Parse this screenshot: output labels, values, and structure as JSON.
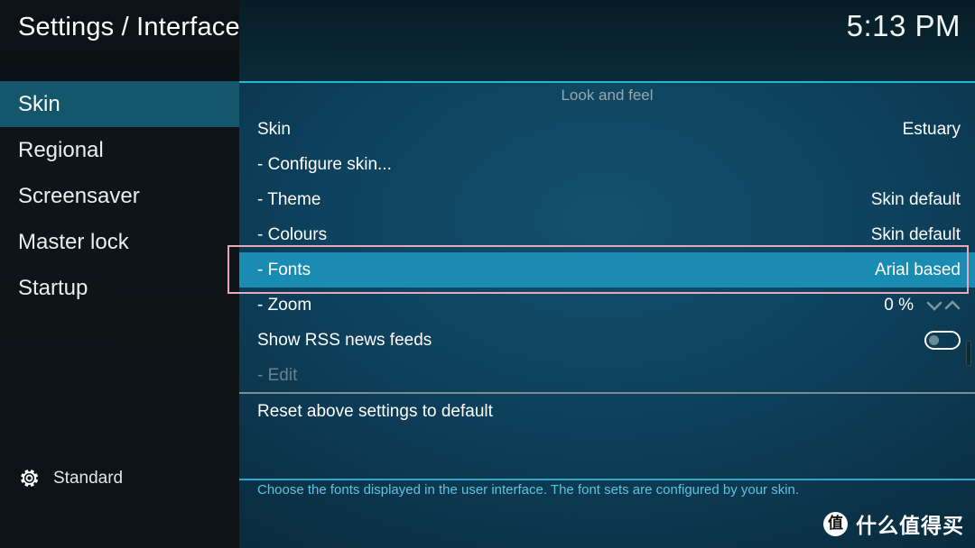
{
  "header": {
    "title": "Settings / Interface",
    "clock": "5:13 PM"
  },
  "sidebar": {
    "items": [
      {
        "label": "Skin",
        "selected": true
      },
      {
        "label": "Regional",
        "selected": false
      },
      {
        "label": "Screensaver",
        "selected": false
      },
      {
        "label": "Master lock",
        "selected": false
      },
      {
        "label": "Startup",
        "selected": false
      }
    ],
    "settings_level": {
      "icon": "gear-icon",
      "label": "Standard"
    }
  },
  "content": {
    "group_header": "Look and feel",
    "rows": [
      {
        "label": "Skin",
        "value": "Estuary",
        "type": "value"
      },
      {
        "label": "- Configure skin...",
        "value": "",
        "type": "action"
      },
      {
        "label": "- Theme",
        "value": "Skin default",
        "type": "value"
      },
      {
        "label": "- Colours",
        "value": "Skin default",
        "type": "value"
      },
      {
        "label": "- Fonts",
        "value": "Arial based",
        "type": "value",
        "focused": true
      },
      {
        "label": "- Zoom",
        "value": "0 %",
        "type": "spinner"
      },
      {
        "label": "Show RSS news feeds",
        "value": "",
        "type": "toggle",
        "toggle_on": false
      },
      {
        "label": "- Edit",
        "value": "",
        "type": "action",
        "disabled": true
      }
    ],
    "reset_row": {
      "label": "Reset above settings to default"
    },
    "help_text": "Choose the fonts displayed in the user interface. The font sets are configured by your skin."
  },
  "watermark": {
    "logo_glyph": "值",
    "text": "什么值得买"
  },
  "colors": {
    "focus_highlight": "#1a8cb4",
    "sidebar_selected": "#14576c",
    "accent_rule": "#29b3d6",
    "help_text": "#5fc3e0",
    "annotation_box": "#e8a8bb"
  }
}
